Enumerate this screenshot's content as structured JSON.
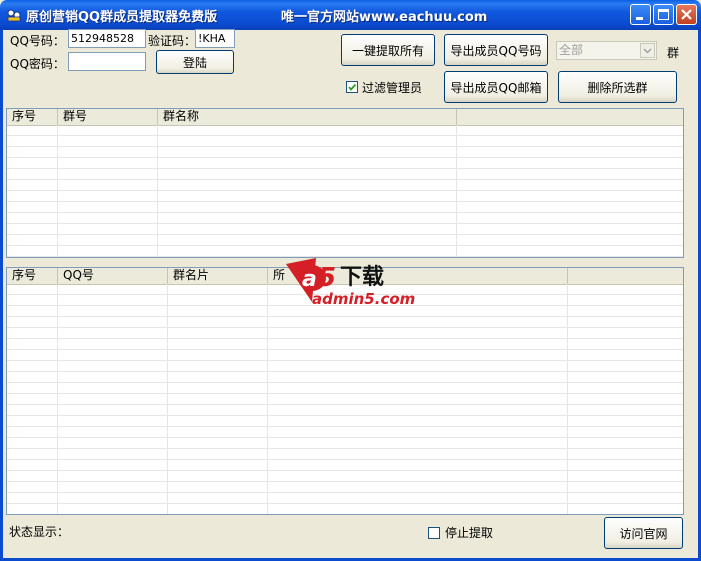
{
  "window": {
    "title": "原创营销QQ群成员提取器免费版",
    "website_notice": "唯一官方网站www.eachuu.com"
  },
  "login": {
    "qq_label": "QQ号码：",
    "qq_value": "512948528",
    "captcha_label": "验证码：",
    "captcha_value": "!KHA",
    "password_label": "QQ密码：",
    "password_value": "",
    "login_button": "登陆"
  },
  "actions": {
    "extract_all": "一键提取所有",
    "export_qq_numbers": "导出成员QQ号码",
    "export_qq_emails": "导出成员QQ邮箱",
    "delete_selected_groups": "删除所选群",
    "filter_admin_label": "过滤管理员",
    "filter_admin_checked": true,
    "group_select_value": "全部",
    "group_select_suffix": "群"
  },
  "group_list": {
    "columns": [
      "序号",
      "群号",
      "群名称",
      ""
    ]
  },
  "member_list": {
    "columns": [
      "序号",
      "QQ号",
      "群名片",
      "所",
      ""
    ]
  },
  "watermark": {
    "brand": "a5",
    "text": "下载",
    "domain": "admin5.com"
  },
  "footer": {
    "status_label": "状态显示：",
    "stop_label": "停止提取",
    "stop_checked": false,
    "visit_site_button": "访问官网"
  },
  "colors": {
    "titlebar": "#0b4bd0",
    "window_bg": "#ece9d8",
    "close_button": "#c24020"
  }
}
